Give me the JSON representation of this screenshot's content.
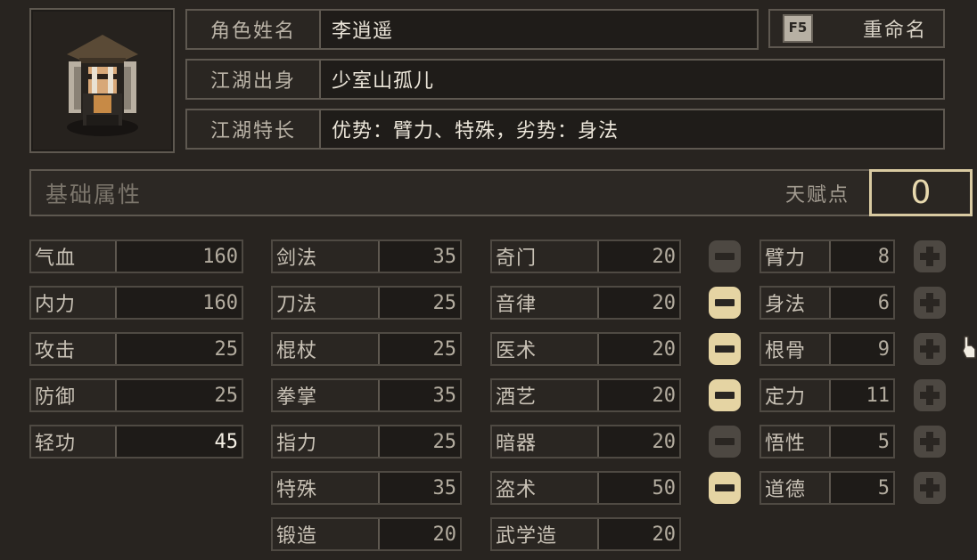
{
  "header": {
    "name_label": "角色姓名",
    "name_value": "李逍遥",
    "origin_label": "江湖出身",
    "origin_value": "少室山孤儿",
    "specialty_label": "江湖特长",
    "specialty_value": "优势：臂力、特殊，劣势：身法",
    "rename_key": "F5",
    "rename_label": "重命名"
  },
  "base": {
    "title": "基础属性",
    "talent_label": "天赋点",
    "talent_points": "0"
  },
  "col1": [
    {
      "label": "气血",
      "value": "160"
    },
    {
      "label": "内力",
      "value": "160"
    },
    {
      "label": "攻击",
      "value": "25"
    },
    {
      "label": "防御",
      "value": "25"
    },
    {
      "label": "轻功",
      "value": "45"
    }
  ],
  "col2": [
    {
      "label": "剑法",
      "value": "35"
    },
    {
      "label": "刀法",
      "value": "25"
    },
    {
      "label": "棍杖",
      "value": "25"
    },
    {
      "label": "拳掌",
      "value": "35"
    },
    {
      "label": "指力",
      "value": "25"
    },
    {
      "label": "特殊",
      "value": "35"
    },
    {
      "label": "锻造",
      "value": "20"
    }
  ],
  "col3": [
    {
      "label": "奇门",
      "value": "20"
    },
    {
      "label": "音律",
      "value": "20"
    },
    {
      "label": "医术",
      "value": "20"
    },
    {
      "label": "酒艺",
      "value": "20"
    },
    {
      "label": "暗器",
      "value": "20"
    },
    {
      "label": "盗术",
      "value": "50"
    },
    {
      "label": "武学造",
      "value": "20"
    }
  ],
  "talents": [
    {
      "label": "臂力",
      "value": "8",
      "minus_enabled": false
    },
    {
      "label": "身法",
      "value": "6",
      "minus_enabled": true
    },
    {
      "label": "根骨",
      "value": "9",
      "minus_enabled": true
    },
    {
      "label": "定力",
      "value": "11",
      "minus_enabled": true
    },
    {
      "label": "悟性",
      "value": "5",
      "minus_enabled": false
    },
    {
      "label": "道德",
      "value": "5",
      "minus_enabled": true
    }
  ],
  "icons": {
    "minus": "minus-icon",
    "plus": "plus-icon",
    "cursor": "hand-cursor-icon"
  },
  "colors": {
    "accent": "#e5d4a3",
    "background": "#282420"
  }
}
